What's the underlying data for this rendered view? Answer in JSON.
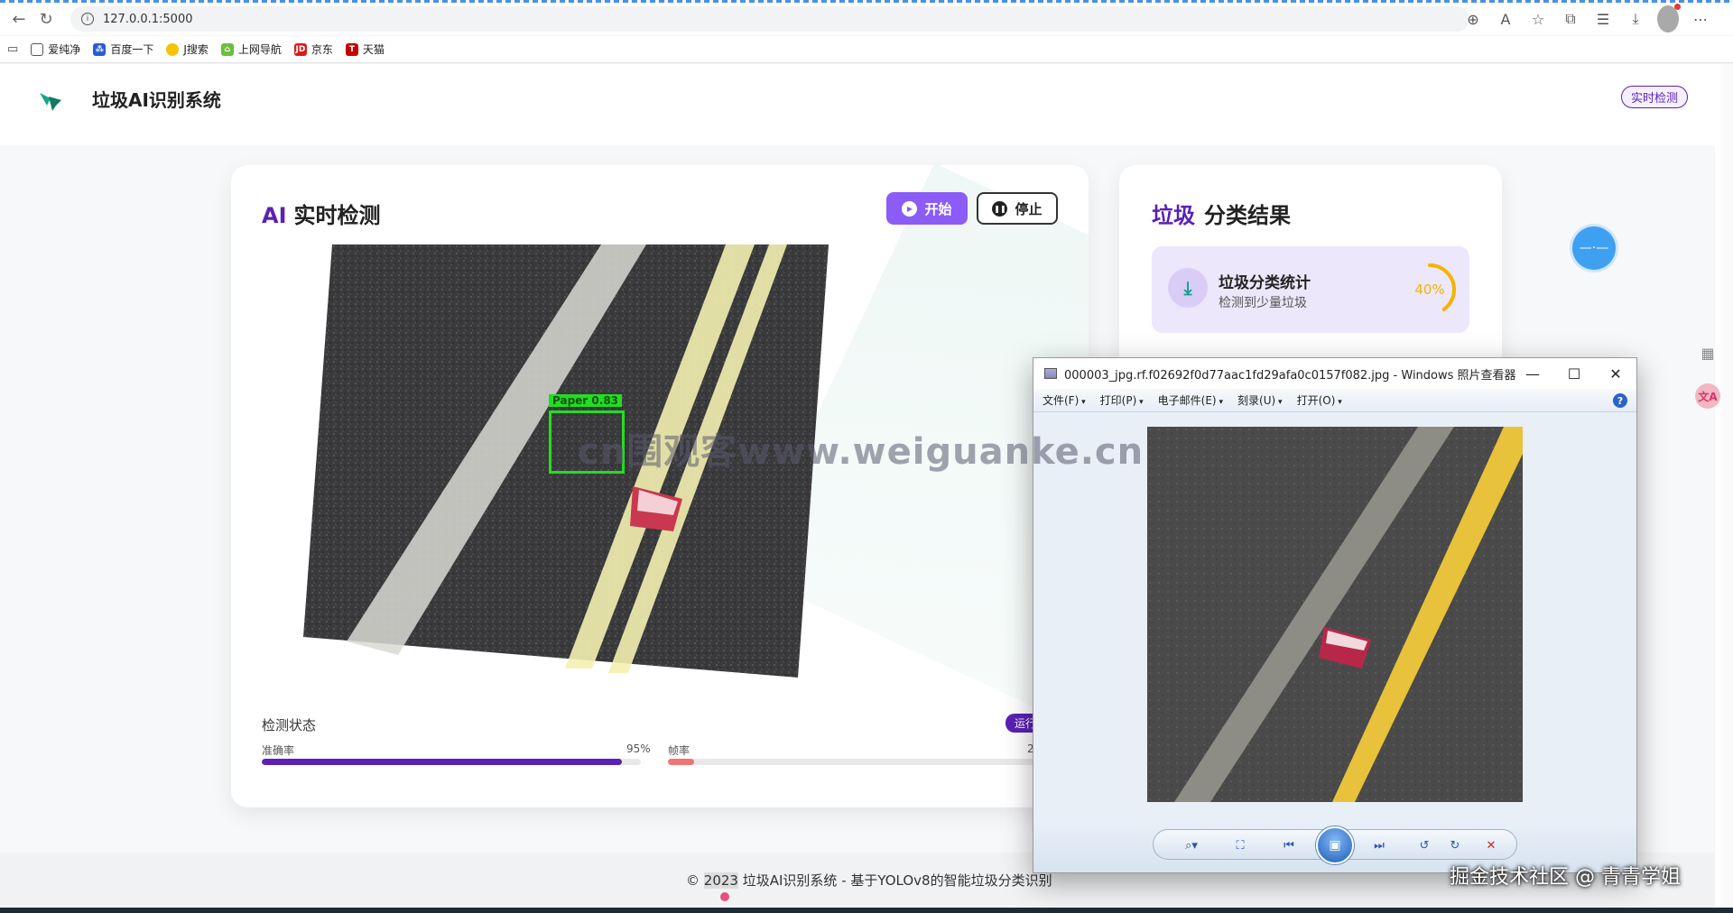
{
  "browser": {
    "url": "127.0.0.1:5000",
    "bookmarks": [
      "爱纯净",
      "百度一下",
      "J搜索",
      "上网导航",
      "京东",
      "天猫"
    ]
  },
  "header": {
    "brand": "垃圾AI识别系统",
    "live_badge": "实时检测"
  },
  "ai_card": {
    "title_accent": "AI",
    "title": "实时检测",
    "start_label": "开始",
    "stop_label": "停止",
    "detection_label": "Paper",
    "detection_score": "0.83",
    "status_title": "检测状态",
    "status_badge": "运行",
    "accuracy_label": "准确率",
    "accuracy_value": "95%",
    "accuracy_fraction": 0.95,
    "fps_label": "帧率",
    "fps_value": "2",
    "fps_fraction": 0.07
  },
  "result_card": {
    "title_accent": "垃圾",
    "title": "分类结果",
    "stat_name": "垃圾分类统计",
    "stat_sub": "检测到少量垃圾",
    "stat_percent": "40%",
    "stat_fraction": 0.4
  },
  "footer": {
    "copyright": "©",
    "year": "2023",
    "text": "垃圾AI识别系统 - 基于YOLOv8的智能垃圾分类识别"
  },
  "viewer": {
    "title": "000003_jpg.rf.f02692f0d77aac1fd29afa0c0157f082.jpg - Windows 照片查看器",
    "menu": [
      "文件(F)",
      "打印(P)",
      "电子邮件(E)",
      "刻录(U)",
      "打开(O)"
    ]
  },
  "watermark": "cn围观客www.weiguanke.cn",
  "credit": "掘金技术社区 @ 青青学姐",
  "colors": {
    "accent": "#5b21b6",
    "start_button": "#8b5cf6",
    "ring": "#f5b301",
    "fps_bar": "#f07474"
  }
}
